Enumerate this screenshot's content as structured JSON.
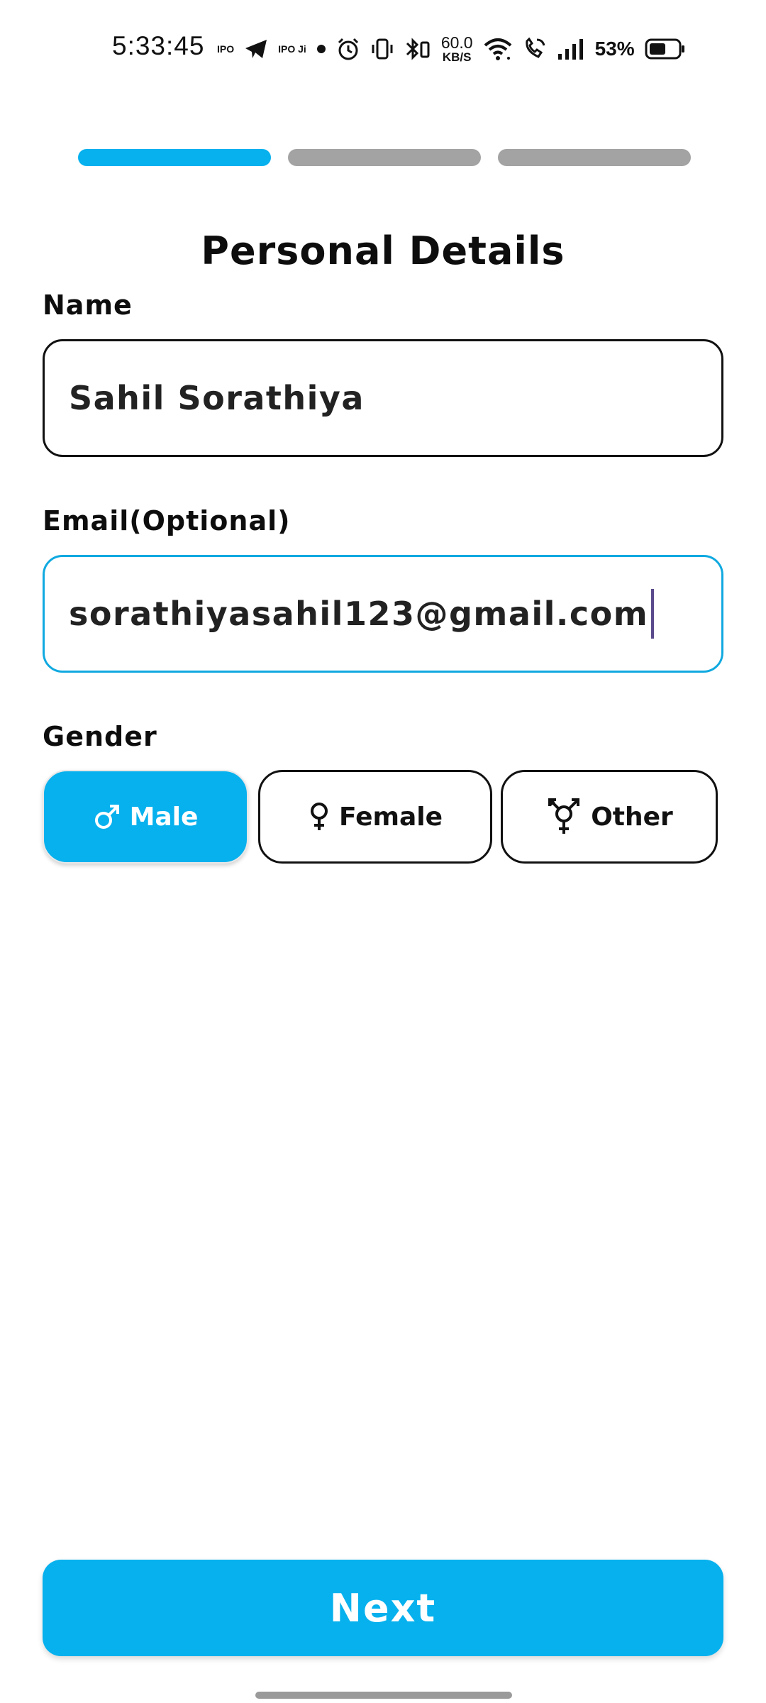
{
  "status_bar": {
    "time": "5:33:45",
    "notif_ipo_premium": "IPO",
    "notif_ipoji": "IPO Ji",
    "net_speed_value": "60.0",
    "net_speed_unit": "KB/S",
    "battery_percent": "53%",
    "icons": [
      "ipo-premium-icon",
      "telegram-icon",
      "ipoji-icon",
      "notification-dot-icon",
      "alarm-icon",
      "vibrate-icon",
      "bluetooth-icon",
      "wifi-icon",
      "wifi-calling-icon",
      "signal-icon",
      "battery-icon"
    ]
  },
  "progress": {
    "total_steps": 3,
    "current_step": 1,
    "active_color": "#06b1ee",
    "inactive_color": "#a3a3a3"
  },
  "page": {
    "title": "Personal Details"
  },
  "form": {
    "name_label": "Name",
    "name_value": "Sahil Sorathiya",
    "email_label": "Email(Optional)",
    "email_value": "sorathiyasahil123@gmail.com",
    "gender_label": "Gender",
    "gender_options": [
      {
        "label": "Male",
        "icon": "male-icon",
        "selected": true
      },
      {
        "label": "Female",
        "icon": "female-icon",
        "selected": false
      },
      {
        "label": "Other",
        "icon": "transgender-icon",
        "selected": false
      }
    ]
  },
  "actions": {
    "next_label": "Next"
  },
  "colors": {
    "accent": "#06b1ee",
    "focus_border": "#10a9e0",
    "text": "#111111"
  }
}
